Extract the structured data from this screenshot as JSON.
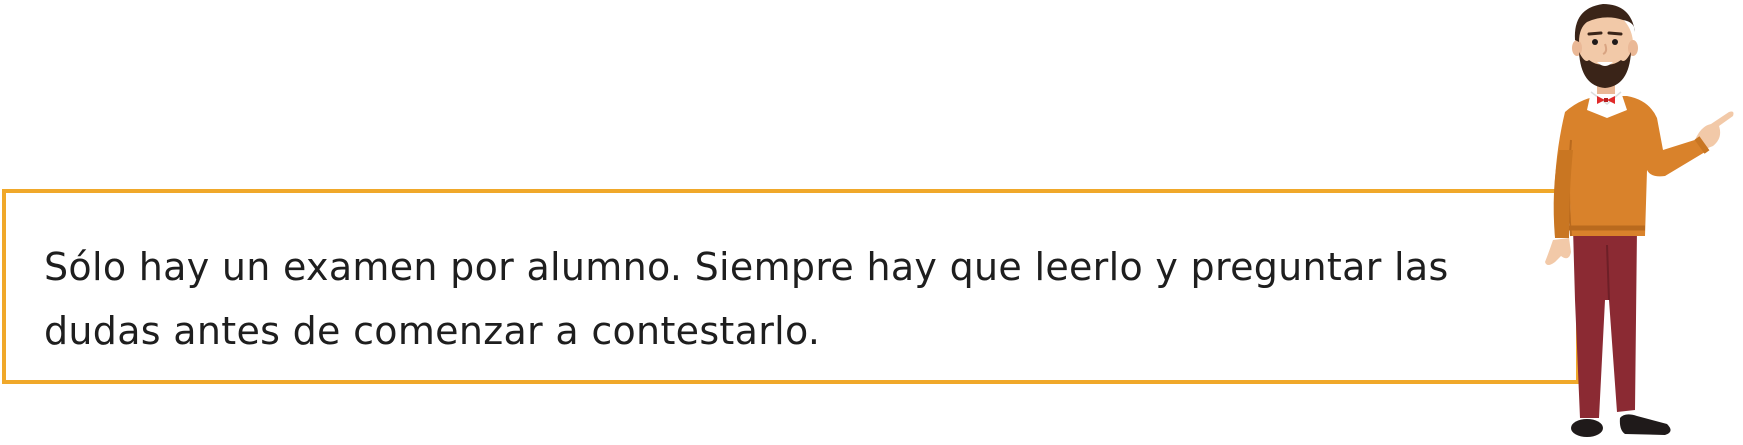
{
  "note": {
    "text": "Sólo hay un examen por alumno. Siempre hay que leerlo y preguntar las dudas antes de comenzar a contestarlo."
  },
  "illustration": {
    "subject": "teacher-character-pointing",
    "colors": {
      "border": "#f0a82a",
      "sweater": "#d9822b",
      "pants": "#8b2a33",
      "hair": "#3a2418",
      "bowtie": "#e02a2a",
      "skin": "#f2c9a8"
    }
  }
}
